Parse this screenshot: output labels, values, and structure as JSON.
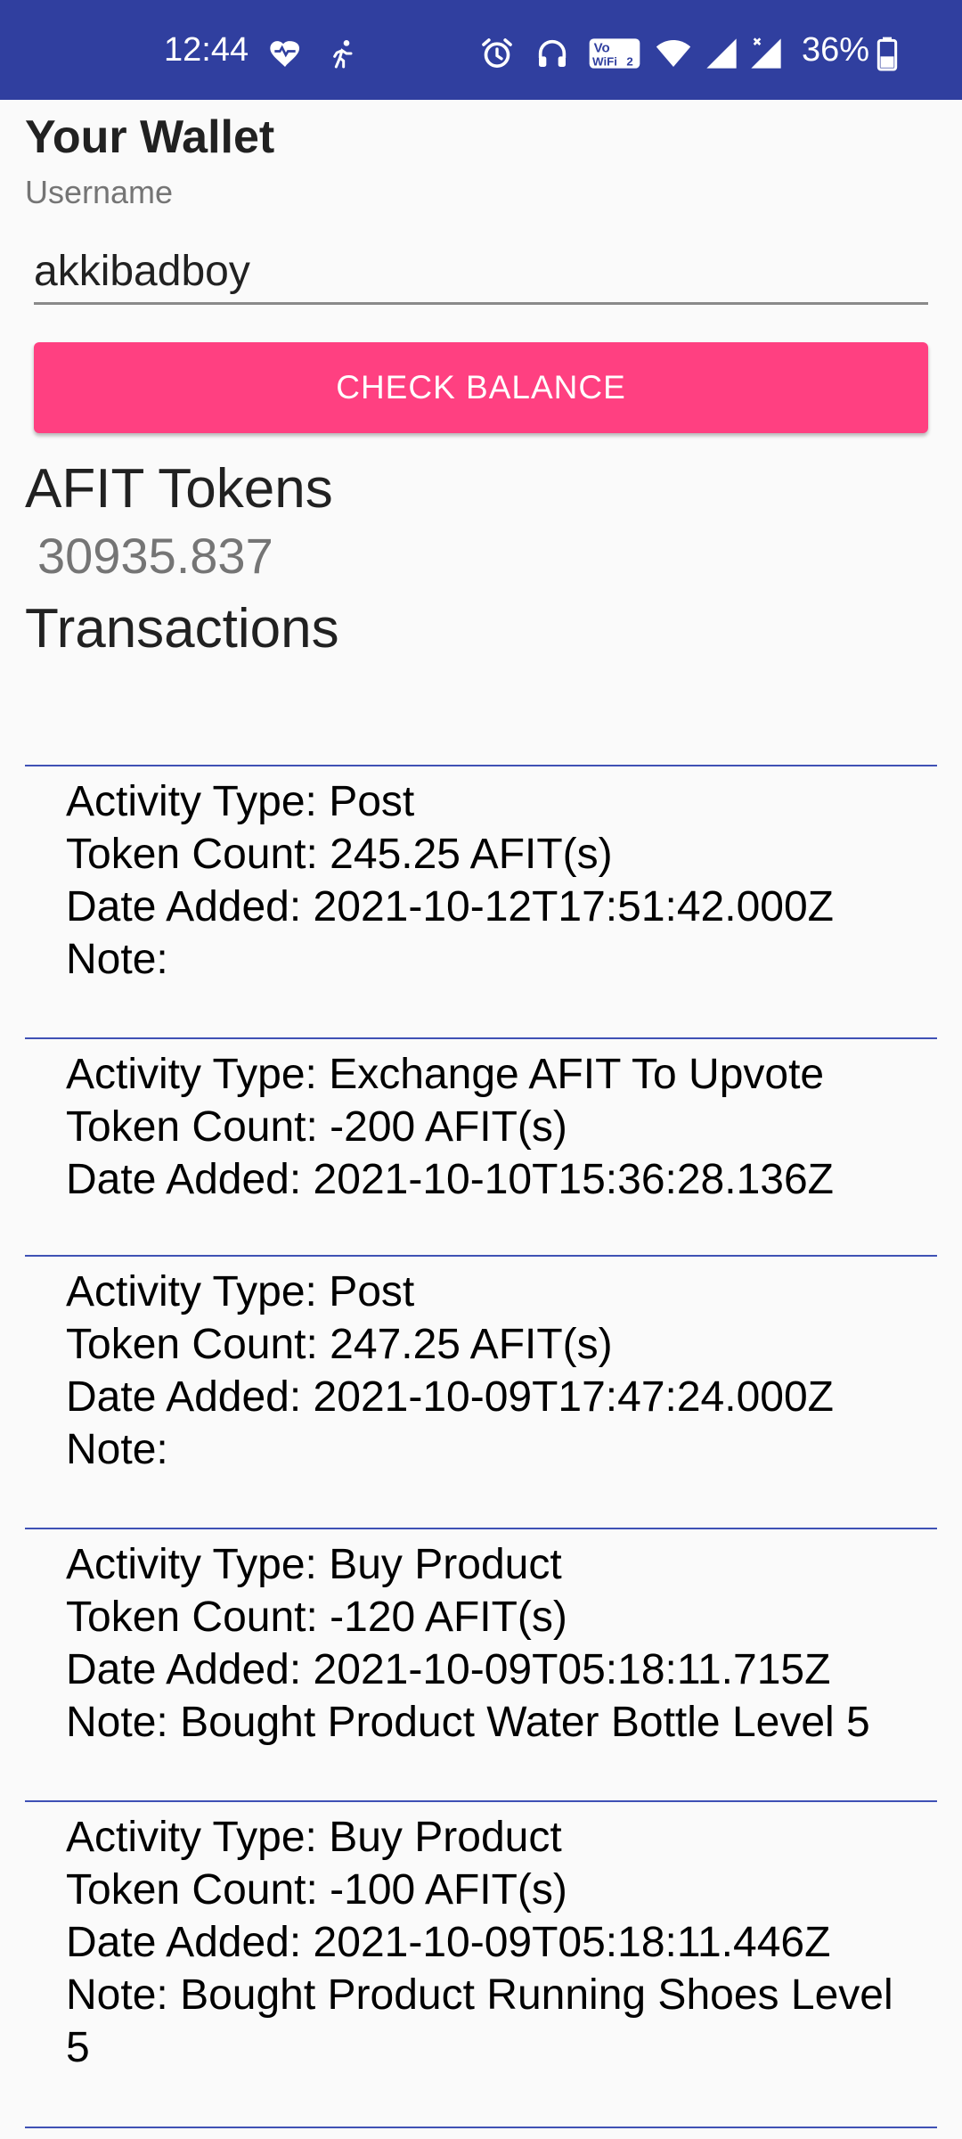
{
  "status_bar": {
    "time": "12:44",
    "battery_percent": "36%",
    "background_color": "#303f9f",
    "icons": [
      "heart-icon",
      "running-icon",
      "alarm-icon",
      "headphones-icon",
      "vowifi-icon",
      "wifi-icon",
      "signal-icon",
      "signal-x-icon",
      "battery-icon"
    ]
  },
  "wallet": {
    "title": "Your Wallet",
    "username_label": "Username",
    "username_value": "akkibadboy",
    "check_balance_label": "CHECK BALANCE",
    "accent_color": "#ff4081"
  },
  "tokens": {
    "heading": "AFIT Tokens",
    "value": "30935.837"
  },
  "transactions": {
    "heading": "Transactions",
    "items": [
      {
        "activity": "Activity Type: Post",
        "tokens": "Token Count: 245.25 AFIT(s)",
        "date": "Date Added: 2021-10-12T17:51:42.000Z",
        "note": "Note:"
      },
      {
        "activity": "Activity Type: Exchange AFIT To Upvote",
        "tokens": "Token Count: -200 AFIT(s)",
        "date": "Date Added: 2021-10-10T15:36:28.136Z"
      },
      {
        "activity": "Activity Type: Post",
        "tokens": "Token Count: 247.25 AFIT(s)",
        "date": "Date Added: 2021-10-09T17:47:24.000Z",
        "note": "Note:"
      },
      {
        "activity": "Activity Type: Buy Product",
        "tokens": "Token Count: -120 AFIT(s)",
        "date": "Date Added: 2021-10-09T05:18:11.715Z",
        "note": "Note: Bought Product Water Bottle Level 5"
      },
      {
        "activity": "Activity Type: Buy Product",
        "tokens": "Token Count: -100 AFIT(s)",
        "date": "Date Added: 2021-10-09T05:18:11.446Z",
        "note": "Note: Bought Product Running Shoes Level 5"
      }
    ]
  }
}
